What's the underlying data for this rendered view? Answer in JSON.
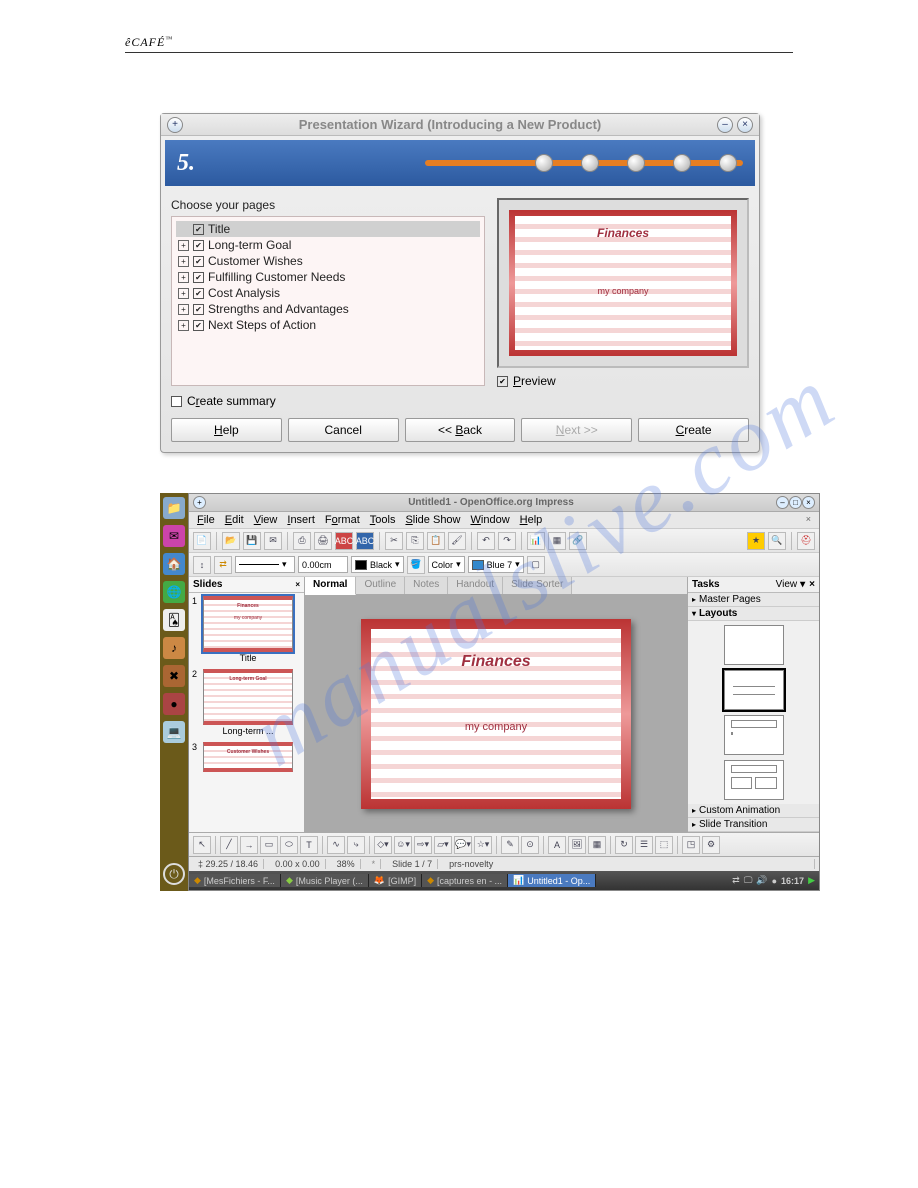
{
  "pageHeader": {
    "brand": "êCAFÉ",
    "tm": "™"
  },
  "watermark": "manualslive.com",
  "wizard": {
    "title": "Presentation Wizard (Introducing a New Product)",
    "step": "5.",
    "sectionLabel": "Choose your pages",
    "items": [
      {
        "label": "Title",
        "checked": true,
        "expand": false,
        "selected": true
      },
      {
        "label": "Long-term Goal",
        "checked": true,
        "expand": true,
        "selected": false
      },
      {
        "label": "Customer Wishes",
        "checked": true,
        "expand": true,
        "selected": false
      },
      {
        "label": "Fulfilling Customer Needs",
        "checked": true,
        "expand": true,
        "selected": false
      },
      {
        "label": "Cost Analysis",
        "checked": true,
        "expand": true,
        "selected": false
      },
      {
        "label": "Strengths and Advantages",
        "checked": true,
        "expand": true,
        "selected": false
      },
      {
        "label": "Next Steps of Action",
        "checked": true,
        "expand": true,
        "selected": false
      }
    ],
    "createSummary": {
      "label": "Create summary",
      "checked": false
    },
    "preview": {
      "title": "Finances",
      "subtitle": "my company",
      "checkboxLabel": "Preview",
      "checked": true
    },
    "buttons": {
      "help": "Help",
      "cancel": "Cancel",
      "back": "<< Back",
      "next": "Next >>",
      "create": "Create"
    }
  },
  "impress": {
    "title": "Untitled1 - OpenOffice.org Impress",
    "menu": [
      "File",
      "Edit",
      "View",
      "Insert",
      "Format",
      "Tools",
      "Slide Show",
      "Window",
      "Help"
    ],
    "toolbar2": {
      "size": "0.00cm",
      "colorName": "Black",
      "fillLabel": "Color",
      "fillName": "Blue 7"
    },
    "slidesPane": {
      "title": "Slides",
      "thumbs": [
        {
          "n": "1",
          "title": "Finances",
          "sub": "my company",
          "label": "Title",
          "selected": true
        },
        {
          "n": "2",
          "title": "Long-term Goal",
          "sub": "",
          "label": "Long-term ...",
          "selected": false
        },
        {
          "n": "3",
          "title": "Customer Wishes",
          "sub": "",
          "label": "",
          "selected": false
        }
      ]
    },
    "viewTabs": [
      "Normal",
      "Outline",
      "Notes",
      "Handout",
      "Slide Sorter"
    ],
    "mainSlide": {
      "title": "Finances",
      "subtitle": "my company"
    },
    "tasksPane": {
      "title": "Tasks",
      "viewLabel": "View",
      "sections": {
        "master": "Master Pages",
        "layouts": "Layouts",
        "custom": "Custom Animation",
        "transition": "Slide Transition"
      }
    },
    "status": {
      "coords": "‡ 29.25 / 18.46",
      "size": "0.00 x 0.00",
      "zoom": "38%",
      "slide": "Slide 1 / 7",
      "template": "prs-novelty"
    },
    "taskbar": {
      "items": [
        "[MesFichiers - F...",
        "[Music Player (...",
        "[GIMP]",
        "[captures en - ...",
        "Untitled1 - Op..."
      ],
      "clock": "16:17"
    }
  }
}
